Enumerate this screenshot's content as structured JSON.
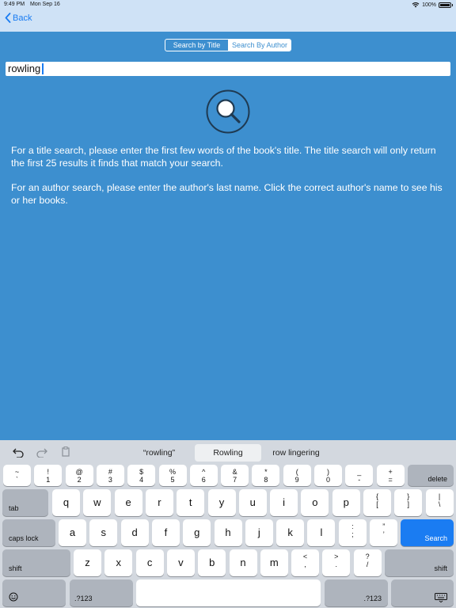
{
  "status": {
    "time": "9:49 PM",
    "date": "Mon Sep 16",
    "battery": "100%",
    "battery_level": 1.0
  },
  "nav": {
    "back_label": "Back"
  },
  "segment": {
    "title_label": "Search by Title",
    "author_label": "Search By Author",
    "selected": "author"
  },
  "search": {
    "value": "rowling"
  },
  "help": {
    "title_text": "For a title search, please enter the first few words of the book's title. The title search will only return the first 25 results it finds that match your search.",
    "author_text": "For an author search, please enter the author's last name. Click the correct author's name to see his or her books."
  },
  "colors": {
    "background": "#3d8fcf",
    "nav_bar": "#cfe2f6",
    "accent": "#1a7cf2",
    "keyboard": "#d3d8df"
  },
  "keyboard": {
    "suggestions": [
      "“rowling”",
      "Rowling",
      "row lingering"
    ],
    "number_row": [
      {
        "top": "~",
        "bottom": "`"
      },
      {
        "top": "!",
        "bottom": "1"
      },
      {
        "top": "@",
        "bottom": "2"
      },
      {
        "top": "#",
        "bottom": "3"
      },
      {
        "top": "$",
        "bottom": "4"
      },
      {
        "top": "%",
        "bottom": "5"
      },
      {
        "top": "^",
        "bottom": "6"
      },
      {
        "top": "&",
        "bottom": "7"
      },
      {
        "top": "*",
        "bottom": "8"
      },
      {
        "top": "(",
        "bottom": "9"
      },
      {
        "top": ")",
        "bottom": "0"
      },
      {
        "top": "_",
        "bottom": "-"
      },
      {
        "top": "+",
        "bottom": "="
      }
    ],
    "delete_label": "delete",
    "tab_label": "tab",
    "row_q": [
      "q",
      "w",
      "e",
      "r",
      "t",
      "y",
      "u",
      "i",
      "o",
      "p"
    ],
    "row_q_extra": [
      {
        "top": "{",
        "bottom": "["
      },
      {
        "top": "}",
        "bottom": "]"
      },
      {
        "top": "|",
        "bottom": "\\"
      }
    ],
    "caps_label": "caps lock",
    "row_a": [
      "a",
      "s",
      "d",
      "f",
      "g",
      "h",
      "j",
      "k",
      "l"
    ],
    "row_a_extra": [
      {
        "top": ":",
        "bottom": ";"
      },
      {
        "top": "”",
        "bottom": "’"
      }
    ],
    "search_label": "Search",
    "shift_label": "shift",
    "row_z": [
      "z",
      "x",
      "c",
      "v",
      "b",
      "n",
      "m"
    ],
    "row_z_extra": [
      {
        "top": "<",
        "bottom": ","
      },
      {
        "top": ">",
        "bottom": "."
      },
      {
        "top": "?",
        "bottom": "/"
      }
    ],
    "numbers_label": ".?123",
    "icons": [
      "undo-icon",
      "redo-icon",
      "paste-icon",
      "emoji-icon",
      "dismiss-keyboard-icon"
    ]
  }
}
